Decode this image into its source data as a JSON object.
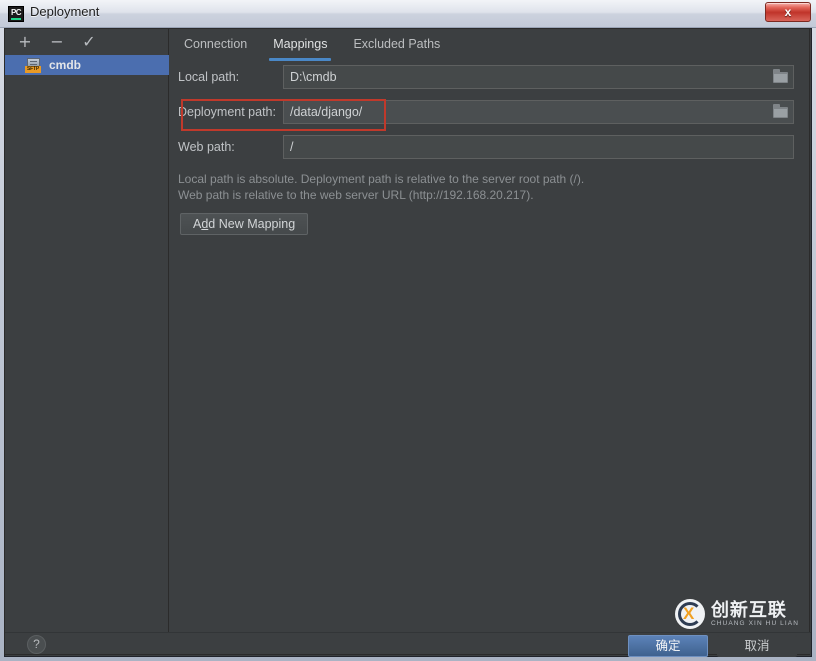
{
  "window": {
    "title": "Deployment",
    "app_icon": "pycharm-icon",
    "close_label": "x",
    "accent_color": "#4a88c7",
    "background_color": "#3c3f41"
  },
  "sidebar": {
    "toolbar": [
      {
        "name": "add-server-button",
        "glyph": "+"
      },
      {
        "name": "remove-server-button",
        "glyph": "−"
      },
      {
        "name": "set-default-button",
        "glyph": "✓"
      }
    ],
    "items": [
      {
        "label": "cmdb",
        "icon": "sftp-server-icon",
        "badge": "SFTP",
        "selected": true
      }
    ]
  },
  "main": {
    "tabs": [
      {
        "label": "Connection",
        "active": false
      },
      {
        "label": "Mappings",
        "active": true
      },
      {
        "label": "Excluded Paths",
        "active": false
      }
    ],
    "fields": [
      {
        "label": "Local path:",
        "value": "D:\\cmdb",
        "placeholder": "",
        "has_browse": true,
        "highlighted": false
      },
      {
        "label": "Deployment path:",
        "value": "/data/django/",
        "placeholder": "",
        "has_browse": true,
        "highlighted": true
      },
      {
        "label": "Web path:",
        "value": "/",
        "placeholder": "",
        "has_browse": false,
        "highlighted": false
      }
    ],
    "hint_line1": "Local path is absolute. Deployment path is relative to the server root path (/).",
    "hint_line2": "Web path is relative to the web server URL (http://192.168.20.217).",
    "add_mapping_prefix": "A",
    "add_mapping_mnemonic": "d",
    "add_mapping_suffix": "d New Mapping",
    "annotation_color": "#c0392b"
  },
  "footer": {
    "help_label": "?",
    "ok_label": "确定",
    "cancel_label": "取消"
  },
  "watermark": {
    "cn_text": "创新互联",
    "pinyin_text": "CHUANG XIN HU LIAN",
    "logo_letter": "X"
  }
}
